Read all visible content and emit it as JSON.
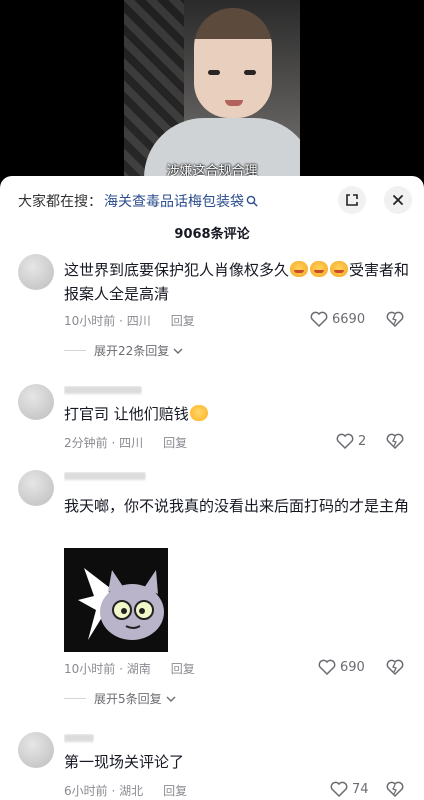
{
  "video": {
    "subtitle": "涉嫌这合规合理"
  },
  "search": {
    "prefix": "大家都在搜：",
    "query": "海关查毒品话梅包装袋"
  },
  "count_title": "9068条评论",
  "comments": [
    {
      "text": "这世界到底要保护犯人肖像权多久",
      "text_tail": "受害者和报案人全是高清",
      "time": "10小时前 · 四川",
      "reply": "回复",
      "likes": "6690",
      "expand": "展开22条回复"
    },
    {
      "text": "打官司 让他们赔钱",
      "time": "2分钟前 · 四川",
      "reply": "回复",
      "likes": "2"
    },
    {
      "text": "我天啷，你不说我真的没看出来后面打码的才是主角",
      "time": "10小时前 · 湖南",
      "reply": "回复",
      "likes": "690",
      "expand": "展开5条回复"
    },
    {
      "text": "第一现场关评论了",
      "time": "6小时前 · 湖北",
      "reply": "回复",
      "likes": "74"
    }
  ],
  "colors": {
    "link": "#2c4d8f",
    "meta": "#8a8b91",
    "text": "#161823"
  },
  "icons": [
    "search-icon",
    "expand-icon",
    "close-icon",
    "heart-icon",
    "dislike-icon",
    "chevron-down-icon"
  ]
}
